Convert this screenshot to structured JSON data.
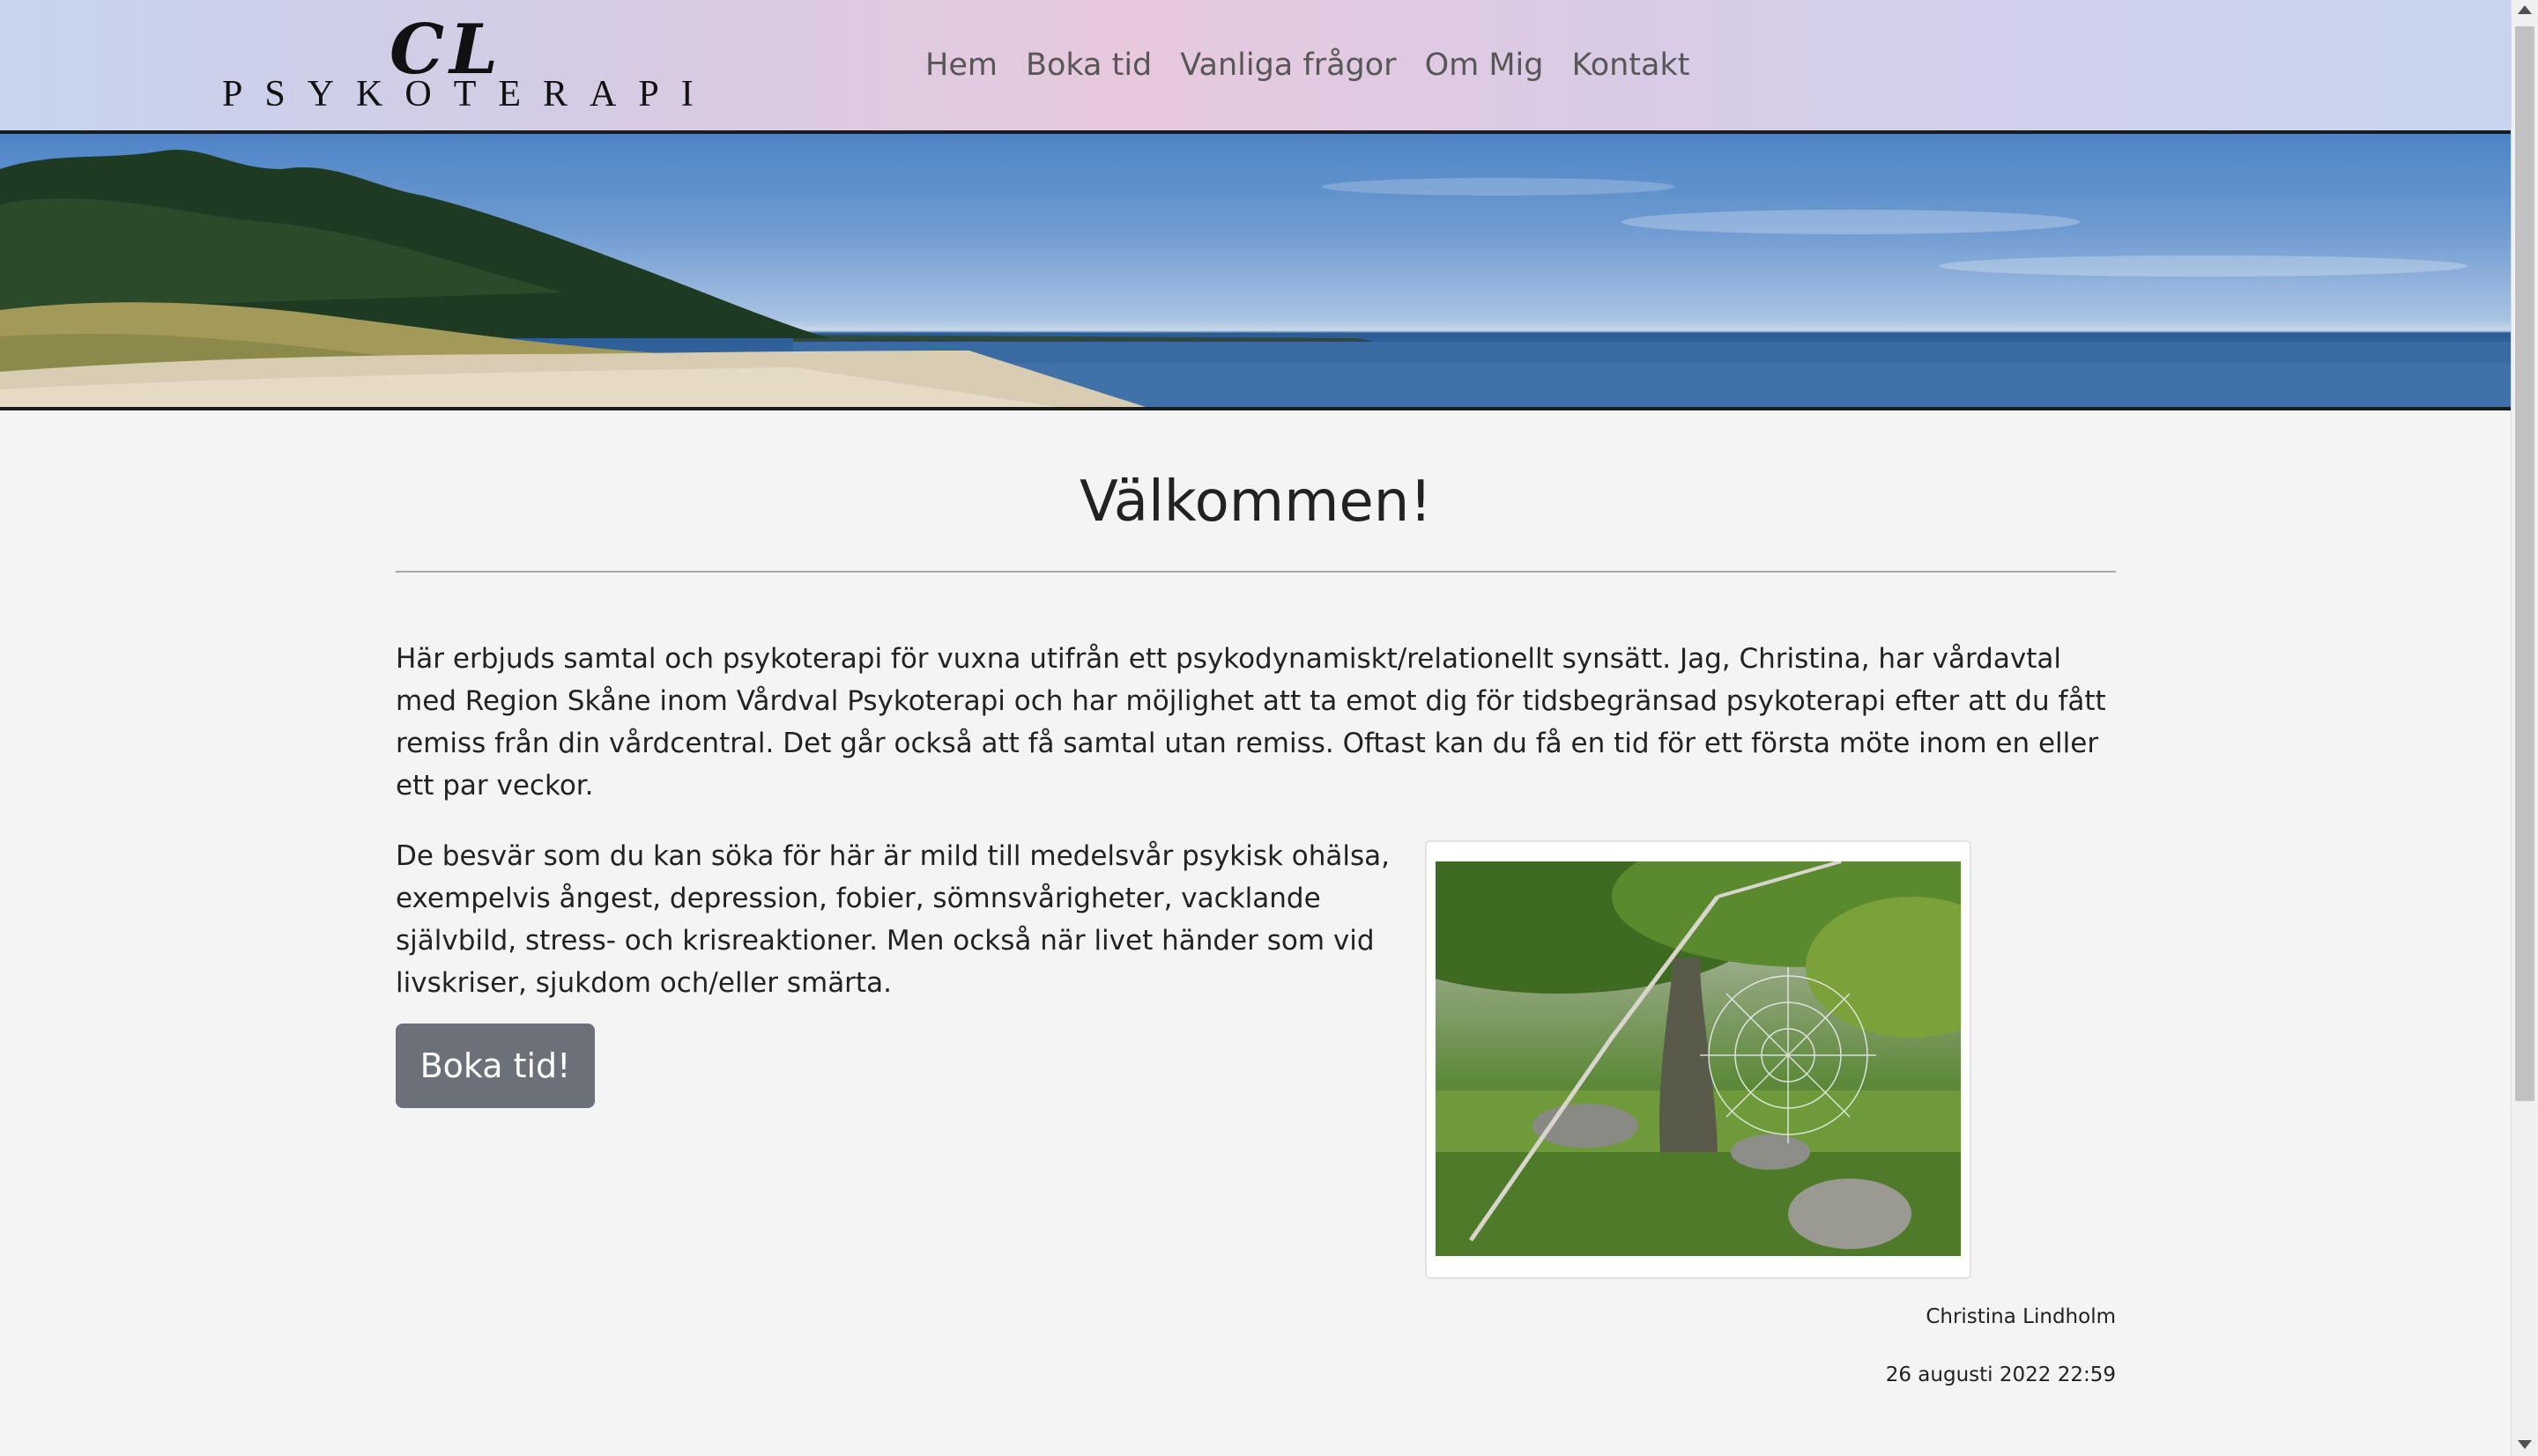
{
  "site": {
    "logo_mark": "CL",
    "logo_text": "PSYKOTERAPI"
  },
  "nav": {
    "items": [
      {
        "label": "Hem"
      },
      {
        "label": "Boka tid"
      },
      {
        "label": "Vanliga frågor"
      },
      {
        "label": "Om Mig"
      },
      {
        "label": "Kontakt"
      }
    ]
  },
  "main": {
    "title": "Välkommen!",
    "intro": "Här erbjuds samtal och psykoterapi för vuxna utifrån ett psykodynamiskt/relationellt synsätt. Jag, Christina, har vårdavtal med Region Skåne inom Vårdval Psykoterapi och har möjlighet att ta emot dig för tidsbegränsad psykoterapi efter att du fått remiss från din vårdcentral. Det går också att få samtal utan remiss. Oftast kan du få en tid för ett första möte inom en eller ett par veckor.",
    "paragraph2": "De besvär som du kan söka för här är mild till medelsvår psykisk ohälsa, exempelvis ångest, depression, fobier, sömnsvårigheter, vacklande självbild, stress- och krisreaktioner. Men också när livet händer som vid livskriser, sjukdom och/eller smärta.",
    "cta_label": "Boka tid!",
    "author": "Christina Lindholm",
    "datetime": "26 augusti 2022 22:59"
  },
  "colors": {
    "header_gradient_start": "#c6d4ee",
    "header_gradient_mid": "#e7c9de",
    "button_bg": "#6c7079",
    "page_bg": "#f4f4f4"
  }
}
